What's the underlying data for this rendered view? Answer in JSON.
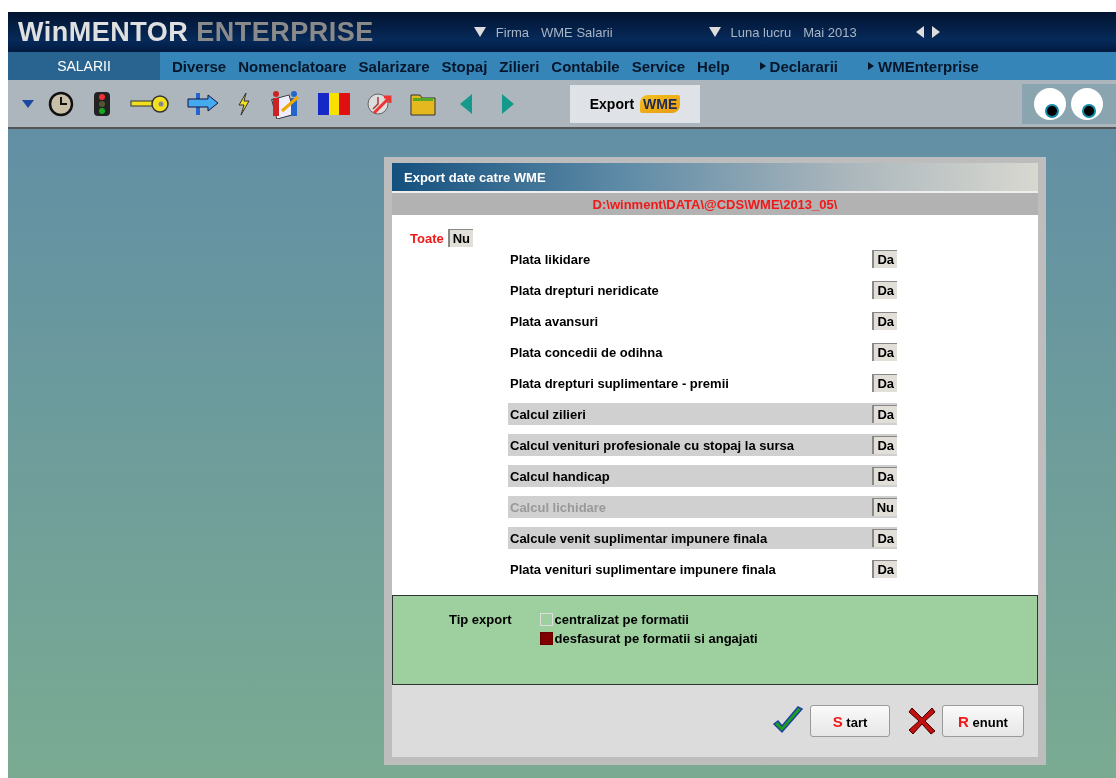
{
  "header": {
    "logo_primary": "WinMENTOR",
    "logo_secondary": "ENTERPRISE",
    "company_label": "Firma",
    "company": "WME Salarii",
    "month_label": "Luna lucru",
    "month": "Mai 2013"
  },
  "menu": {
    "module": "SALARII",
    "items": [
      "Diverse",
      "Nomenclatoare",
      "Salarizare",
      "Stopaj",
      "Zilieri",
      "Contabile",
      "Service",
      "Help"
    ],
    "links": [
      "Declararii",
      "WMEnterprise"
    ]
  },
  "toolbar": {
    "export_button": {
      "label": "Export",
      "badge": "WME"
    }
  },
  "dialog": {
    "title": "Export date catre WME",
    "path": "D:\\winment\\DATA\\@CDS\\WME\\2013_05\\",
    "all_label": "Toate",
    "all_value": "Nu",
    "rows": [
      {
        "label": "Plata likidare",
        "value": "Da",
        "kind": "plain",
        "disabled": false
      },
      {
        "label": "Plata drepturi neridicate",
        "value": "Da",
        "kind": "plain",
        "disabled": false
      },
      {
        "label": "Plata avansuri",
        "value": "Da",
        "kind": "plain",
        "disabled": false
      },
      {
        "label": "Plata concedii de odihna",
        "value": "Da",
        "kind": "plain",
        "disabled": false
      },
      {
        "label": "Plata drepturi suplimentare - premii",
        "value": "Da",
        "kind": "plain",
        "disabled": false
      },
      {
        "label": "Calcul zilieri",
        "value": "Da",
        "kind": "shaded",
        "disabled": false
      },
      {
        "label": "Calcul venituri profesionale cu stopaj la sursa",
        "value": "Da",
        "kind": "shaded",
        "disabled": false
      },
      {
        "label": "Calcul handicap",
        "value": "Da",
        "kind": "shaded",
        "disabled": false
      },
      {
        "label": "Calcul lichidare",
        "value": "Nu",
        "kind": "shaded",
        "disabled": true
      },
      {
        "label": "Calcule venit suplimentar impunere finala",
        "value": "Da",
        "kind": "shaded",
        "disabled": false
      },
      {
        "label": "Plata venituri suplimentare impunere finala",
        "value": "Da",
        "kind": "plain",
        "disabled": false
      }
    ],
    "export_type": {
      "label": "Tip export",
      "options": [
        {
          "label": "centralizat pe  formatii",
          "selected": false
        },
        {
          "label": "desfasurat  pe formatii si angajati",
          "selected": true
        }
      ]
    },
    "buttons": [
      {
        "kind": "confirm",
        "accel": "S",
        "label": "tart"
      },
      {
        "kind": "cancel",
        "accel": "R",
        "label": "enunt"
      }
    ]
  }
}
